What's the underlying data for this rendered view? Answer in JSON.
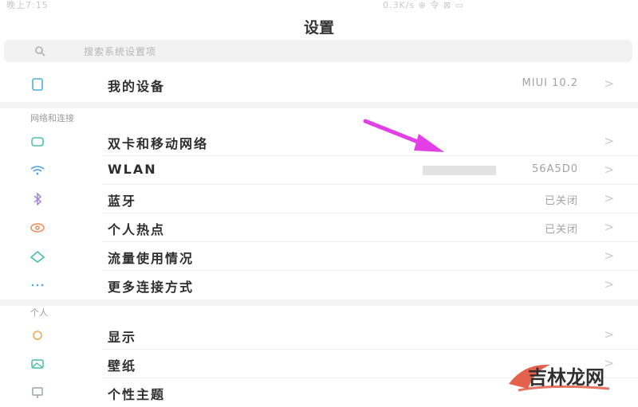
{
  "status_bar": {
    "left_text": "晚上7:15",
    "right_text": "0.3K/s ⊕ 令 ⊠ ▭"
  },
  "header": {
    "title": "设置"
  },
  "search": {
    "placeholder": "搜索系统设置项"
  },
  "my_device": {
    "label": "我的设备",
    "value": "MIUI 10.2"
  },
  "network_section": {
    "title": "网络和连接",
    "items": [
      {
        "label": "双卡和移动网络",
        "value": "",
        "icon": "dual-sim-icon",
        "color": "#49c3a3"
      },
      {
        "label": "WLAN",
        "value": "56A5D0",
        "icon": "wifi-icon",
        "color": "#4d9fe5"
      },
      {
        "label": "蓝牙",
        "value": "已关闭",
        "icon": "bluetooth-icon",
        "color": "#9a7de0"
      },
      {
        "label": "个人热点",
        "value": "已关闭",
        "icon": "hotspot-icon",
        "color": "#f08a5a"
      },
      {
        "label": "流量使用情况",
        "value": "",
        "icon": "data-usage-icon",
        "color": "#3fbfae"
      },
      {
        "label": "更多连接方式",
        "value": "",
        "icon": "more-connections-icon",
        "color": "#4aa6e0"
      }
    ]
  },
  "personal_section": {
    "title": "个人",
    "items": [
      {
        "label": "显示",
        "value": "",
        "icon": "display-icon",
        "color": "#f0a94a"
      },
      {
        "label": "壁纸",
        "value": "",
        "icon": "wallpaper-icon",
        "color": "#45bfa0"
      },
      {
        "label": "个性主题",
        "value": "",
        "icon": "theme-icon",
        "color": "#9aa3b0"
      }
    ]
  },
  "chevron": ">",
  "annotation": {
    "arrow_color": "#e23fe6"
  },
  "watermark": {
    "text": "吉林龙网"
  }
}
